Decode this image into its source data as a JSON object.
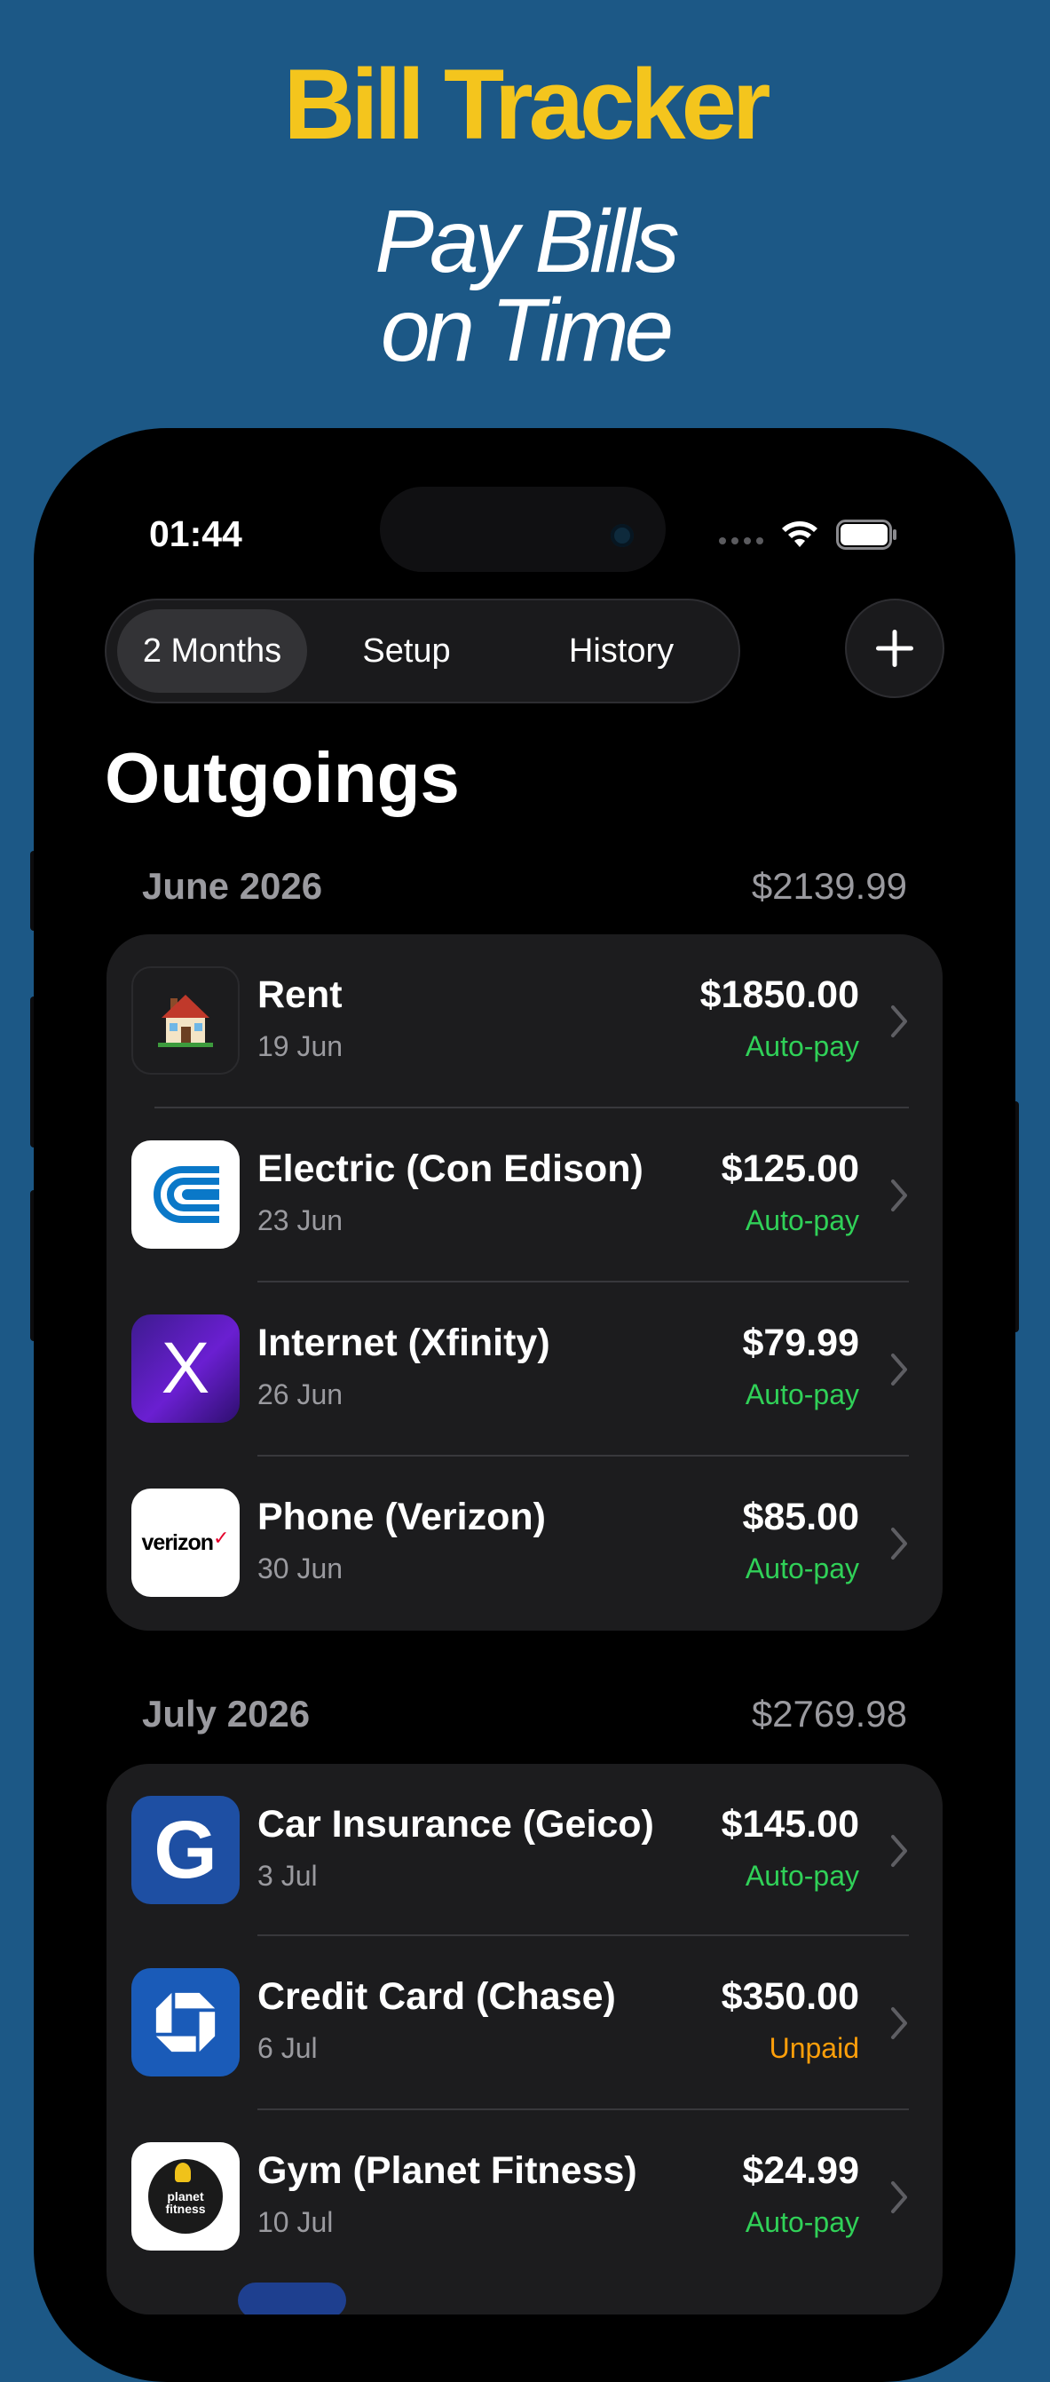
{
  "promo": {
    "title": "Bill Tracker",
    "subtitle_line1": "Pay Bills",
    "subtitle_line2": "on Time"
  },
  "status_bar": {
    "time": "01:44"
  },
  "tabs": [
    {
      "label": "2 Months",
      "selected": true
    },
    {
      "label": "Setup",
      "selected": false
    },
    {
      "label": "History",
      "selected": false
    }
  ],
  "add_button_icon": "plus-icon",
  "page_title": "Outgoings",
  "colors": {
    "autopay": "#30d158",
    "unpaid": "#ff9f0a",
    "promo_title": "#f4c51d",
    "background": "#1c5886"
  },
  "sections": [
    {
      "month": "June 2026",
      "total": "$2139.99",
      "bills": [
        {
          "name": "Rent",
          "date": "19 Jun",
          "amount": "$1850.00",
          "status": "Auto-pay",
          "icon": "house-icon"
        },
        {
          "name": "Electric (Con Edison)",
          "date": "23 Jun",
          "amount": "$125.00",
          "status": "Auto-pay",
          "icon": "con-edison-logo"
        },
        {
          "name": "Internet (Xfinity)",
          "date": "26 Jun",
          "amount": "$79.99",
          "status": "Auto-pay",
          "icon": "xfinity-logo",
          "logo_text": "X"
        },
        {
          "name": "Phone (Verizon)",
          "date": "30 Jun",
          "amount": "$85.00",
          "status": "Auto-pay",
          "icon": "verizon-logo",
          "logo_text": "verizon"
        }
      ]
    },
    {
      "month": "July 2026",
      "total": "$2769.98",
      "bills": [
        {
          "name": "Car Insurance (Geico)",
          "date": "3 Jul",
          "amount": "$145.00",
          "status": "Auto-pay",
          "icon": "geico-logo",
          "logo_text": "G"
        },
        {
          "name": "Credit Card (Chase)",
          "date": "6 Jul",
          "amount": "$350.00",
          "status": "Unpaid",
          "icon": "chase-logo"
        },
        {
          "name": "Gym (Planet Fitness)",
          "date": "10 Jul",
          "amount": "$24.99",
          "status": "Auto-pay",
          "icon": "planet-fitness-logo",
          "logo_text": "planet fitness"
        }
      ]
    }
  ]
}
